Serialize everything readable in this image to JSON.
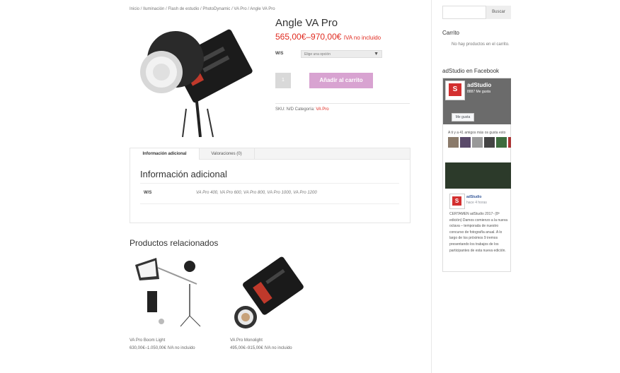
{
  "breadcrumb": "Inicio / Iluminación / Flash de estudio / PhotoDynamic / VA Pro / Angle VA Pro",
  "product": {
    "title": "Angle VA Pro",
    "price": "565,00€–970,00€",
    "tax_note": "IVA no incluido",
    "variation_label": "W/S",
    "select_placeholder": "Elige una opción",
    "quantity": "1",
    "add_to_cart": "Añadir al carrito",
    "sku_label": "SKU: N/D Categoría:",
    "category": "VA Pro"
  },
  "tabs": {
    "items": [
      "Información adicional",
      "Valoraciones (0)"
    ],
    "panel_title": "Información adicional",
    "attr_key": "W/S",
    "attr_value": "VA Pro 400, VA Pro 600, VA Pro 800, VA Pro 1000, VA Pro 1200"
  },
  "related": {
    "title": "Productos relacionados",
    "items": [
      {
        "name": "VA Pro Boom Light",
        "price": "630,00€–1.050,00€ IVA no incluido"
      },
      {
        "name": "VA Pro Monolight",
        "price": "495,00€–915,00€ IVA no incluido"
      }
    ]
  },
  "sidebar": {
    "search_button": "Buscar",
    "cart_title": "Carrito",
    "cart_empty": "No hay productos en el carrito.",
    "fb_title": "adStudio en Facebook",
    "fb_page_name": "adStudio",
    "fb_likes": "8887 Me gusta",
    "fb_like_button": "Me gusta",
    "fb_friends": "A ti y a 41 amigos más os gusta esto",
    "fb_post_author": "adStudio",
    "fb_post_time": "hace 4 horas",
    "fb_post_text": "CERTAMEN adStudio 2017- (8ª edición) Damos comienzo a la nueva octava – temporada de nuestro concurso de fotografía anual. A lo largo de los próximos 9 iremos presentando los trabajos de los participantes de esta nueva edición."
  }
}
